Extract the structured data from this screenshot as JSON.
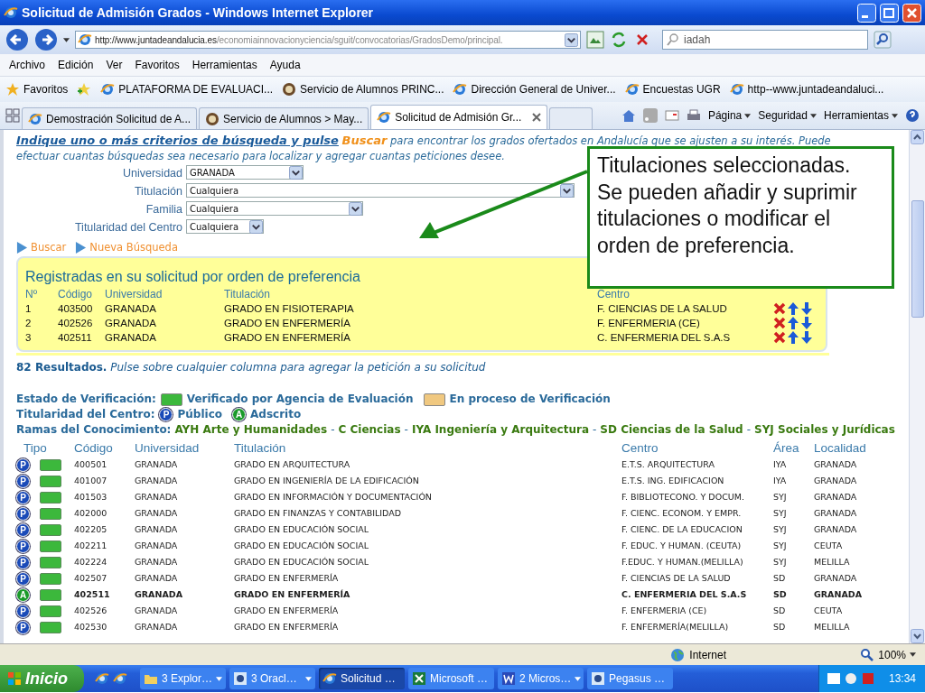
{
  "window": {
    "title": "Solicitud de Admisión Grados - Windows Internet Explorer"
  },
  "address_bar": {
    "url_host": "http://www.juntadeandalucia.es",
    "url_path": "/economiainnovacionyciencia/sguit/convocatorias/GradosDemo/principal.",
    "search_value": "iadah"
  },
  "menu": [
    "Archivo",
    "Edición",
    "Ver",
    "Favoritos",
    "Herramientas",
    "Ayuda"
  ],
  "favorites_bar": {
    "label": "Favoritos",
    "links": [
      {
        "label": "PLATAFORMA DE EVALUACI...",
        "kind": "ie"
      },
      {
        "label": "Servicio de Alumnos  PRINC...",
        "kind": "seal"
      },
      {
        "label": "Dirección General de Univer...",
        "kind": "ie"
      },
      {
        "label": "Encuestas UGR",
        "kind": "ie"
      },
      {
        "label": "http--www.juntadeandaluci...",
        "kind": "ie"
      }
    ]
  },
  "tabs": [
    {
      "label": "Demostración Solicitud de A...",
      "kind": "ie",
      "selected": false
    },
    {
      "label": "Servicio de Alumnos > May...",
      "kind": "seal",
      "selected": false
    },
    {
      "label": "Solicitud de Admisión Gr...",
      "kind": "ie",
      "selected": true
    }
  ],
  "command_bar": [
    "Página",
    "Seguridad",
    "Herramientas"
  ],
  "search_form": {
    "lead": "Indique uno o más criterios de búsqueda y pulse",
    "action": "Buscar",
    "rest": "para encontrar los grados ofertados en Andalucía que se ajusten a su interés. Puede efectuar cuantas búsquedas sea necesario para localizar y agregar cuantas peticiones desee.",
    "filters": [
      {
        "label": "Universidad",
        "value": "GRANADA"
      },
      {
        "label": "Titulación",
        "value": "Cualquiera"
      },
      {
        "label": "Familia",
        "value": "Cualquiera"
      },
      {
        "label": "Titularidad del Centro",
        "value": "Cualquiera"
      }
    ],
    "buttons": [
      "Buscar",
      "Nueva Búsqueda"
    ]
  },
  "requests": {
    "title": "Registradas en su solicitud por orden de preferencia",
    "columns": [
      "Nº",
      "Código",
      "Universidad",
      "Titulación",
      "Centro"
    ],
    "rows": [
      {
        "cells": [
          "1",
          "403500",
          "GRANADA",
          "GRADO EN FISIOTERAPIA",
          "F. CIENCIAS DE LA SALUD"
        ]
      },
      {
        "cells": [
          "2",
          "402526",
          "GRANADA",
          "GRADO EN ENFERMERÍA",
          "F. ENFERMERIA (CE)"
        ]
      },
      {
        "cells": [
          "3",
          "402511",
          "GRANADA",
          "GRADO EN ENFERMERÍA",
          "C. ENFERMERIA DEL S.A.S"
        ]
      }
    ]
  },
  "results": {
    "count": "82 Resultados.",
    "hint": "Pulse sobre cualquier columna para agregar la petición a su solicitud"
  },
  "legend": {
    "verification_label": "Estado de Verificación:",
    "verification": [
      {
        "label": "Verificado por Agencia de Evaluación",
        "color": "#3cb83c"
      },
      {
        "label": "En proceso de Verificación",
        "color": "#f0c880"
      }
    ],
    "ownership_label": "Titularidad del Centro:",
    "ownership": [
      {
        "kind": "public",
        "letter": "P",
        "label": "Público"
      },
      {
        "kind": "attached",
        "letter": "A",
        "label": "Adscrito"
      }
    ],
    "branches_label": "Ramas del Conocimiento:",
    "separator": "-",
    "branches": [
      {
        "code": "AYH",
        "label": "Arte y Humanidades"
      },
      {
        "code": "C",
        "label": "Ciencias"
      },
      {
        "code": "IYA",
        "label": "Ingeniería y Arquitectura"
      },
      {
        "code": "SD",
        "label": "Ciencias de la Salud"
      },
      {
        "code": "SYJ",
        "label": "Sociales y Jurídicas"
      }
    ]
  },
  "table": {
    "type_header": "Tipo",
    "columns": [
      "Código",
      "Universidad",
      "Titulación",
      "Centro",
      "Área",
      "Localidad"
    ],
    "rows": [
      {
        "kind": "public",
        "letter": "P",
        "verified": true,
        "selected": false,
        "cells": [
          "400501",
          "GRANADA",
          "GRADO EN ARQUITECTURA",
          "E.T.S. ARQUITECTURA",
          "IYA",
          "GRANADA"
        ]
      },
      {
        "kind": "public",
        "letter": "P",
        "verified": true,
        "selected": false,
        "cells": [
          "401007",
          "GRANADA",
          "GRADO EN INGENIERÍA DE LA EDIFICACIÓN",
          "E.T.S. ING. EDIFICACION",
          "IYA",
          "GRANADA"
        ]
      },
      {
        "kind": "public",
        "letter": "P",
        "verified": true,
        "selected": false,
        "cells": [
          "401503",
          "GRANADA",
          "GRADO EN INFORMACIÓN Y DOCUMENTACIÓN",
          "F. BIBLIOTECONO. Y DOCUM.",
          "SYJ",
          "GRANADA"
        ]
      },
      {
        "kind": "public",
        "letter": "P",
        "verified": true,
        "selected": false,
        "cells": [
          "402000",
          "GRANADA",
          "GRADO EN FINANZAS Y CONTABILIDAD",
          "F. CIENC. ECONOM. Y EMPR.",
          "SYJ",
          "GRANADA"
        ]
      },
      {
        "kind": "public",
        "letter": "P",
        "verified": true,
        "selected": false,
        "cells": [
          "402205",
          "GRANADA",
          "GRADO EN EDUCACIÓN SOCIAL",
          "F. CIENC. DE LA EDUCACION",
          "SYJ",
          "GRANADA"
        ]
      },
      {
        "kind": "public",
        "letter": "P",
        "verified": true,
        "selected": false,
        "cells": [
          "402211",
          "GRANADA",
          "GRADO EN EDUCACIÓN SOCIAL",
          "F. EDUC. Y HUMAN. (CEUTA)",
          "SYJ",
          "CEUTA"
        ]
      },
      {
        "kind": "public",
        "letter": "P",
        "verified": true,
        "selected": false,
        "cells": [
          "402224",
          "GRANADA",
          "GRADO EN EDUCACIÓN SOCIAL",
          "F.EDUC. Y HUMAN.(MELILLA)",
          "SYJ",
          "MELILLA"
        ]
      },
      {
        "kind": "public",
        "letter": "P",
        "verified": true,
        "selected": false,
        "cells": [
          "402507",
          "GRANADA",
          "GRADO EN ENFERMERÍA",
          "F. CIENCIAS DE LA SALUD",
          "SD",
          "GRANADA"
        ]
      },
      {
        "kind": "attached",
        "letter": "A",
        "verified": true,
        "selected": true,
        "cells": [
          "402511",
          "GRANADA",
          "GRADO EN ENFERMERÍA",
          "C. ENFERMERIA DEL S.A.S",
          "SD",
          "GRANADA"
        ]
      },
      {
        "kind": "public",
        "letter": "P",
        "verified": true,
        "selected": false,
        "cells": [
          "402526",
          "GRANADA",
          "GRADO EN ENFERMERÍA",
          "F. ENFERMERIA (CE)",
          "SD",
          "CEUTA"
        ]
      },
      {
        "kind": "public",
        "letter": "P",
        "verified": true,
        "selected": false,
        "cells": [
          "402530",
          "GRANADA",
          "GRADO EN ENFERMERÍA",
          "F. ENFERMERÍA(MELILLA)",
          "SD",
          "MELILLA"
        ]
      }
    ]
  },
  "callout": {
    "text": "Titulaciones seleccionadas. Se pueden añadir y suprimir titulaciones o modificar el orden de preferencia."
  },
  "status_bar": {
    "zone": "Internet",
    "zoom": "100%"
  },
  "taskbar": {
    "start": "Inicio",
    "tasks": [
      {
        "label": "3 Explor…",
        "kind": "folder",
        "grouped": true,
        "selected": false
      },
      {
        "label": "3 Oracl…",
        "kind": "app",
        "grouped": true,
        "selected": false
      },
      {
        "label": "Solicitud …",
        "kind": "ie",
        "grouped": false,
        "selected": true
      },
      {
        "label": "Microsoft …",
        "kind": "excel",
        "grouped": false,
        "selected": false
      },
      {
        "label": "2 Micros…",
        "kind": "word",
        "grouped": true,
        "selected": false
      },
      {
        "label": "Pegasus …",
        "kind": "app",
        "grouped": false,
        "selected": false
      }
    ],
    "clock": "13:34"
  }
}
